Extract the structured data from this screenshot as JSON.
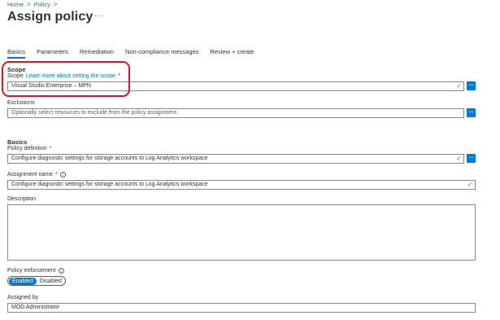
{
  "breadcrumb": {
    "items": [
      "Home",
      "Policy"
    ],
    "separator": ">"
  },
  "page": {
    "title": "Assign policy",
    "more": "···"
  },
  "tabs": [
    {
      "label": "Basics",
      "active": true
    },
    {
      "label": "Parameters"
    },
    {
      "label": "Remediation"
    },
    {
      "label": "Non-compliance messages"
    },
    {
      "label": "Review + create"
    }
  ],
  "scope": {
    "heading": "Scope",
    "label": "Scope",
    "link": "Learn more about setting the scope",
    "required": "*",
    "value": "Visual Studio Enterprise – MPN",
    "button": "...",
    "valid_icon": "checkmark-icon"
  },
  "exclusions": {
    "label": "Exclusions",
    "placeholder": "Optionally select resources to exclude from the policy assignment.",
    "button": "..."
  },
  "basics": {
    "heading": "Basics",
    "policy_definition": {
      "label": "Policy definition",
      "required": "*",
      "value": "Configure diagnostic settings for storage accounts to Log Analytics workspace",
      "button": "..."
    },
    "assignment_name": {
      "label": "Assignment name",
      "required": "*",
      "info": "i",
      "value": "Configure diagnostic settings for storage accounts to Log Analytics workspace"
    },
    "description": {
      "label": "Description",
      "value": ""
    },
    "policy_enforcement": {
      "label": "Policy enforcement",
      "info": "i",
      "options": [
        "Enabled",
        "Disabled"
      ],
      "selected": "Enabled"
    },
    "assigned_by": {
      "label": "Assigned by",
      "value": "MOD Administrator"
    }
  },
  "colors": {
    "accent": "#0078d4",
    "highlight": "#e81123",
    "valid": "#57a300"
  }
}
